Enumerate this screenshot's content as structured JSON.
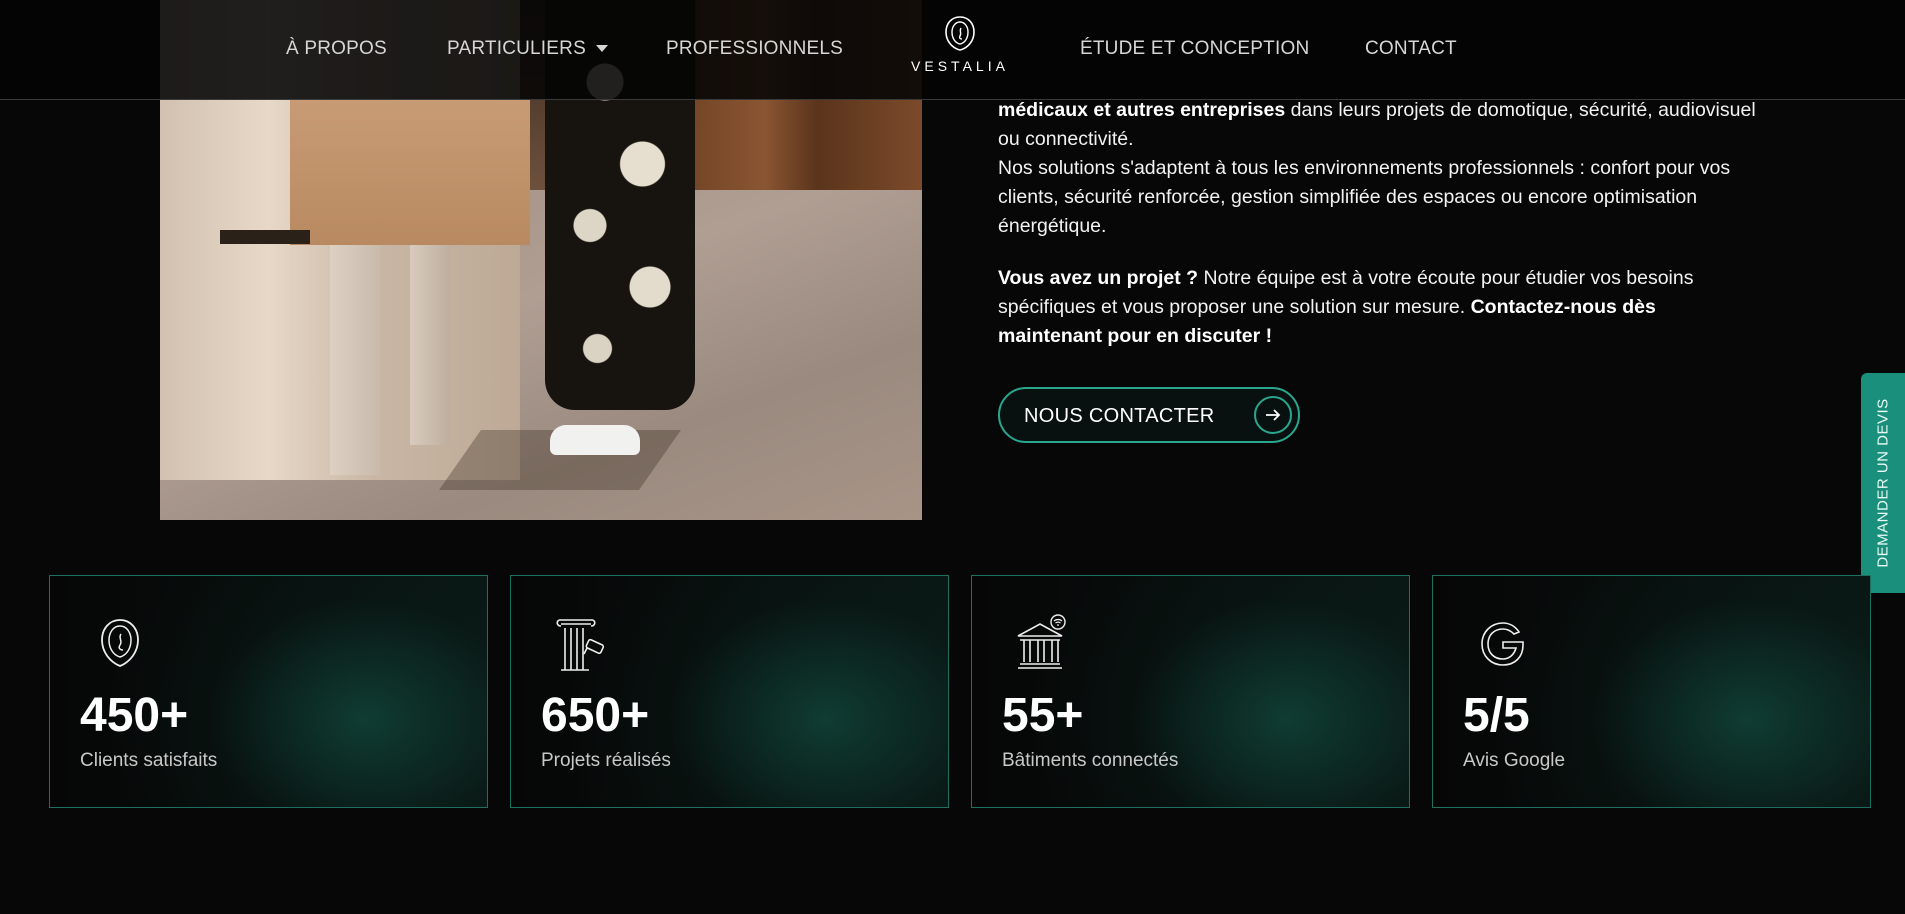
{
  "nav": {
    "items": [
      {
        "label": "À PROPOS"
      },
      {
        "label": "PARTICULIERS"
      },
      {
        "label": "PROFESSIONNELS"
      },
      {
        "label": "ÉTUDE ET CONCEPTION"
      },
      {
        "label": "CONTACT"
      }
    ],
    "logo_text": "VESTALIA"
  },
  "intro": {
    "p1_bold": "médicaux et autres entreprises",
    "p1_rest": " dans leurs projets de domotique, sécurité, audiovisuel ou connectivité.",
    "p2": "Nos solutions s'adaptent à tous les environnements professionnels : confort pour vos clients, sécurité renforcée, gestion simplifiée des espaces ou encore optimisation énergétique.",
    "p3_bold1": "Vous avez un projet ?",
    "p3_mid": " Notre équipe est à votre écoute pour étudier vos besoins spécifiques et vous proposer une solution sur mesure. ",
    "p3_bold2": "Contactez-nous dès maintenant pour en discuter !"
  },
  "cta": {
    "label": "NOUS CONTACTER",
    "icon": "arrow-right-icon"
  },
  "side_tab": {
    "label": "DEMANDER UN DEVIS"
  },
  "stats": [
    {
      "value": "450+",
      "label": "Clients satisfaits",
      "icon": "face-icon"
    },
    {
      "value": "650+",
      "label": "Projets réalisés",
      "icon": "column-camera-icon"
    },
    {
      "value": "55+",
      "label": "Bâtiments connectés",
      "icon": "building-wifi-icon"
    },
    {
      "value": "5/5",
      "label": "Avis Google",
      "icon": "google-icon"
    }
  ],
  "colors": {
    "accent": "#2aa68e",
    "background": "#070707",
    "side_tab": "#1a8f7b"
  }
}
